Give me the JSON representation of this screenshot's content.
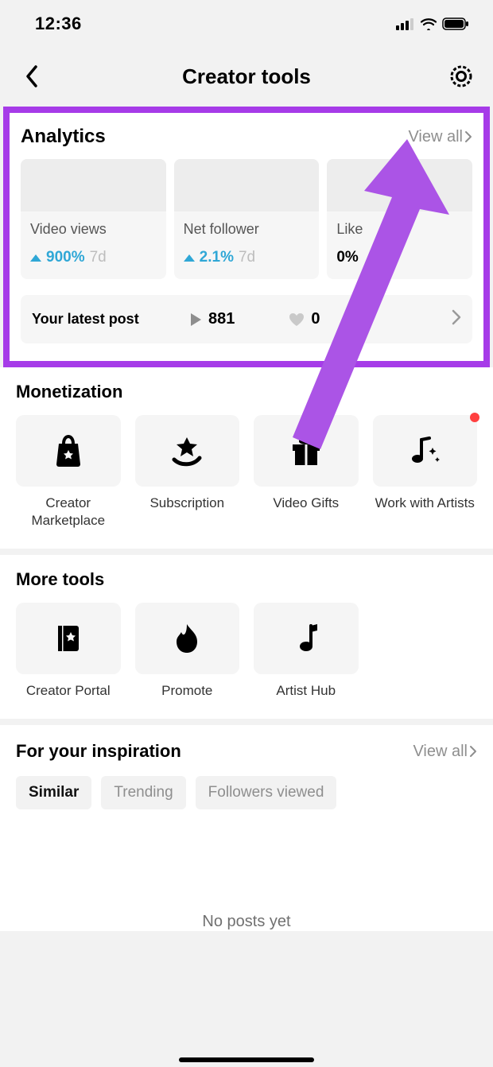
{
  "status": {
    "time": "12:36"
  },
  "header": {
    "title": "Creator tools"
  },
  "analytics": {
    "title": "Analytics",
    "view_all": "View all",
    "cards": [
      {
        "label": "Video views",
        "value": "900%",
        "period": "7d",
        "trend": "up"
      },
      {
        "label": "Net follower",
        "value": "2.1%",
        "period": "7d",
        "trend": "up"
      },
      {
        "label": "Like",
        "value": "0%",
        "period": "",
        "trend": "none"
      }
    ],
    "latest": {
      "label": "Your latest post",
      "plays": "881",
      "likes": "0"
    }
  },
  "monetization": {
    "title": "Monetization",
    "tiles": [
      {
        "label": "Creator Marketplace",
        "icon": "shopping-bag"
      },
      {
        "label": "Subscription",
        "icon": "star-swoosh"
      },
      {
        "label": "Video Gifts",
        "icon": "gift"
      },
      {
        "label": "Work with Artists",
        "icon": "music-sparkle",
        "badge": true
      }
    ]
  },
  "more_tools": {
    "title": "More tools",
    "tiles": [
      {
        "label": "Creator Portal",
        "icon": "book-star"
      },
      {
        "label": "Promote",
        "icon": "flame"
      },
      {
        "label": "Artist Hub",
        "icon": "music-note"
      }
    ]
  },
  "inspiration": {
    "title": "For your inspiration",
    "view_all": "View all",
    "tabs": [
      {
        "label": "Similar",
        "active": true
      },
      {
        "label": "Trending",
        "active": false
      },
      {
        "label": "Followers viewed",
        "active": false
      }
    ],
    "empty_text": "No posts yet"
  },
  "annotation": {
    "highlight_color": "#a63be8"
  }
}
